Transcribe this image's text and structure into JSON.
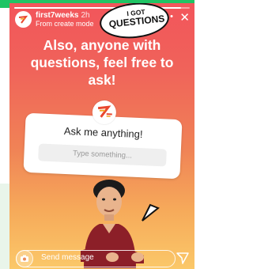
{
  "story": {
    "username": "first7weeks",
    "time": "2h",
    "subtitle": "From create mode",
    "more_icon": "more-dots-icon",
    "close_icon": "close-icon",
    "headline_lines": [
      "Also, anyone with",
      "questions, feel free to",
      "ask!"
    ],
    "progress": 0.95
  },
  "question_sticker": {
    "question": "Ask me anything!",
    "placeholder": "Type something..."
  },
  "photo_sticker": {
    "bubble_line1": "I GOT",
    "bubble_line2": "QUESTIONS"
  },
  "footer": {
    "camera_icon": "camera-icon",
    "message_placeholder": "Send message",
    "send_icon": "send-icon"
  },
  "colors": {
    "frame_green": "#1fc464",
    "gradient_top": "#f2555b",
    "gradient_bottom": "#fbc869"
  }
}
